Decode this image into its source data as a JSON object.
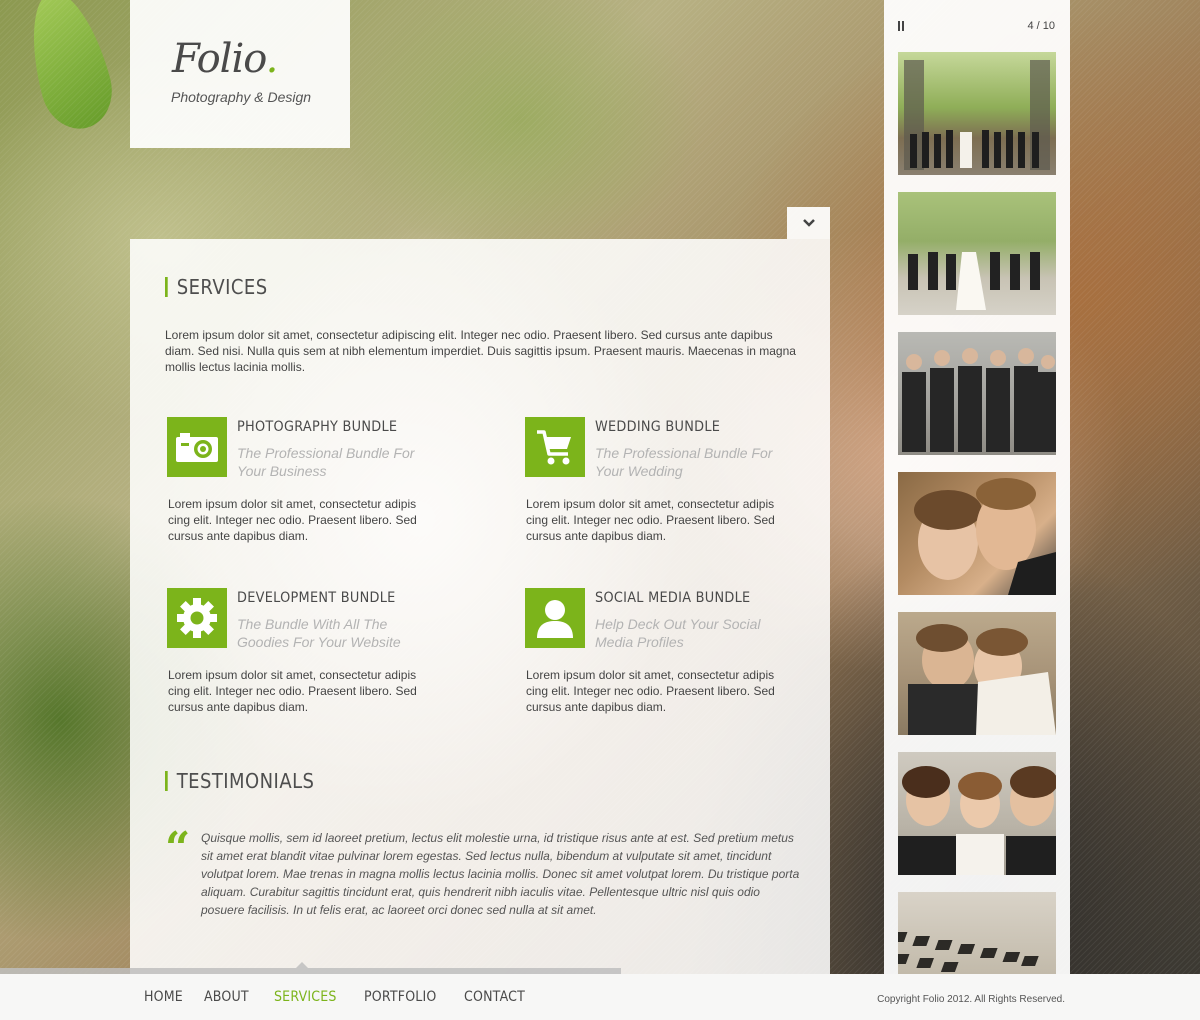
{
  "brand": {
    "name": "Folio",
    "dot": ".",
    "tagline": "Photography & Design"
  },
  "accent_color": "#7cb41b",
  "services": {
    "title": "SERVICES",
    "intro": "Lorem ipsum dolor sit amet, consectetur adipiscing elit. Integer nec odio. Praesent libero. Sed cursus ante dapibus diam. Sed nisi. Nulla quis sem at nibh elementum imperdiet. Duis sagittis ipsum. Praesent mauris. Maecenas in magna mollis lectus lacinia mollis.",
    "items": [
      {
        "icon": "camera-icon",
        "title": "PHOTOGRAPHY BUNDLE",
        "subtitle": "The Professional Bundle For Your Business",
        "description": "Lorem ipsum dolor sit amet, consectetur adipis cing elit. Integer nec odio. Praesent libero. Sed cursus ante dapibus diam."
      },
      {
        "icon": "shopping-cart-icon",
        "title": "WEDDING BUNDLE",
        "subtitle": "The Professional Bundle For Your Wedding",
        "description": "Lorem ipsum dolor sit amet, consectetur adipis cing elit. Integer nec odio. Praesent libero. Sed cursus ante dapibus diam."
      },
      {
        "icon": "gear-icon",
        "title": "DEVELOPMENT BUNDLE",
        "subtitle": "The Bundle With All The Goodies For Your Website",
        "description": "Lorem ipsum dolor sit amet, consectetur adipis cing elit. Integer nec odio. Praesent libero. Sed cursus ante dapibus diam."
      },
      {
        "icon": "user-icon",
        "title": "SOCIAL MEDIA BUNDLE",
        "subtitle": "Help Deck Out Your Social Media Profiles",
        "description": "Lorem ipsum dolor sit amet, consectetur adipis cing elit. Integer nec odio. Praesent libero. Sed cursus ante dapibus diam."
      }
    ]
  },
  "testimonials": {
    "title": "TESTIMONIALS",
    "quote_mark": "“",
    "text": "Quisque mollis, sem id laoreet pretium, lectus elit molestie urna, id tristique risus ante at est. Sed pretium metus sit amet erat blandit vitae pulvinar lorem egestas. Sed lectus nulla, bibendum at vulputate sit amet, tincidunt volutpat lorem. Mae trenas in magna mollis lectus lacinia mollis. Donec sit amet volutpat lorem. Du tristique porta aliquam. Curabitur sagittis tincidunt erat, quis hendrerit nibh iaculis vitae. Pellentesque ultric nisl quis odio posuere facilisis. In ut felis erat, ac laoreet orci donec sed nulla at sit amet."
  },
  "gallery": {
    "counter": "4 / 10",
    "pause_icon": "pause-icon",
    "thumbnails": [
      {
        "name": "thumb-group-trees"
      },
      {
        "name": "thumb-bride-bridesmaids"
      },
      {
        "name": "thumb-groomsmen"
      },
      {
        "name": "thumb-couple-closeup"
      },
      {
        "name": "thumb-couple-kiss"
      },
      {
        "name": "thumb-bride-friends"
      },
      {
        "name": "thumb-place-cards"
      }
    ]
  },
  "nav": {
    "items": [
      {
        "label": "HOME",
        "active": false
      },
      {
        "label": "ABOUT",
        "active": false
      },
      {
        "label": "SERVICES",
        "active": true
      },
      {
        "label": "PORTFOLIO",
        "active": false
      },
      {
        "label": "CONTACT",
        "active": false
      }
    ]
  },
  "footer": {
    "copyright": "Copyright Folio 2012. All Rights Reserved."
  },
  "progress_fraction": 0.52
}
